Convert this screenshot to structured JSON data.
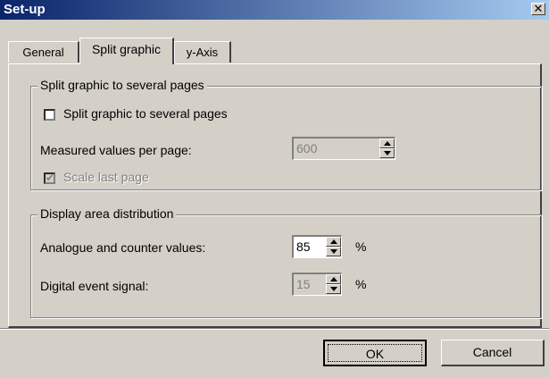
{
  "window": {
    "title": "Set-up",
    "close_glyph": "✕"
  },
  "tabs": [
    {
      "label": "General",
      "active": false
    },
    {
      "label": "Split graphic",
      "active": true
    },
    {
      "label": "y-Axis",
      "active": false
    }
  ],
  "split_group": {
    "title": "Split graphic to several pages",
    "checkbox_label": "Split graphic to several pages",
    "checkbox_checked": false,
    "measured_label": "Measured values per page:",
    "measured_value": "600",
    "scale_label": "Scale last page",
    "scale_checked": true,
    "scale_enabled": false
  },
  "display_group": {
    "title": "Display area distribution",
    "analogue_label": "Analogue and counter values:",
    "analogue_value": "85",
    "analogue_unit": "%",
    "digital_label": "Digital event signal:",
    "digital_value": "15",
    "digital_unit": "%"
  },
  "buttons": {
    "ok": "OK",
    "cancel": "Cancel"
  },
  "icons": {
    "close": "close-icon",
    "spin_up": "arrow-up-icon",
    "spin_down": "arrow-down-icon",
    "check": "checkmark-icon"
  }
}
